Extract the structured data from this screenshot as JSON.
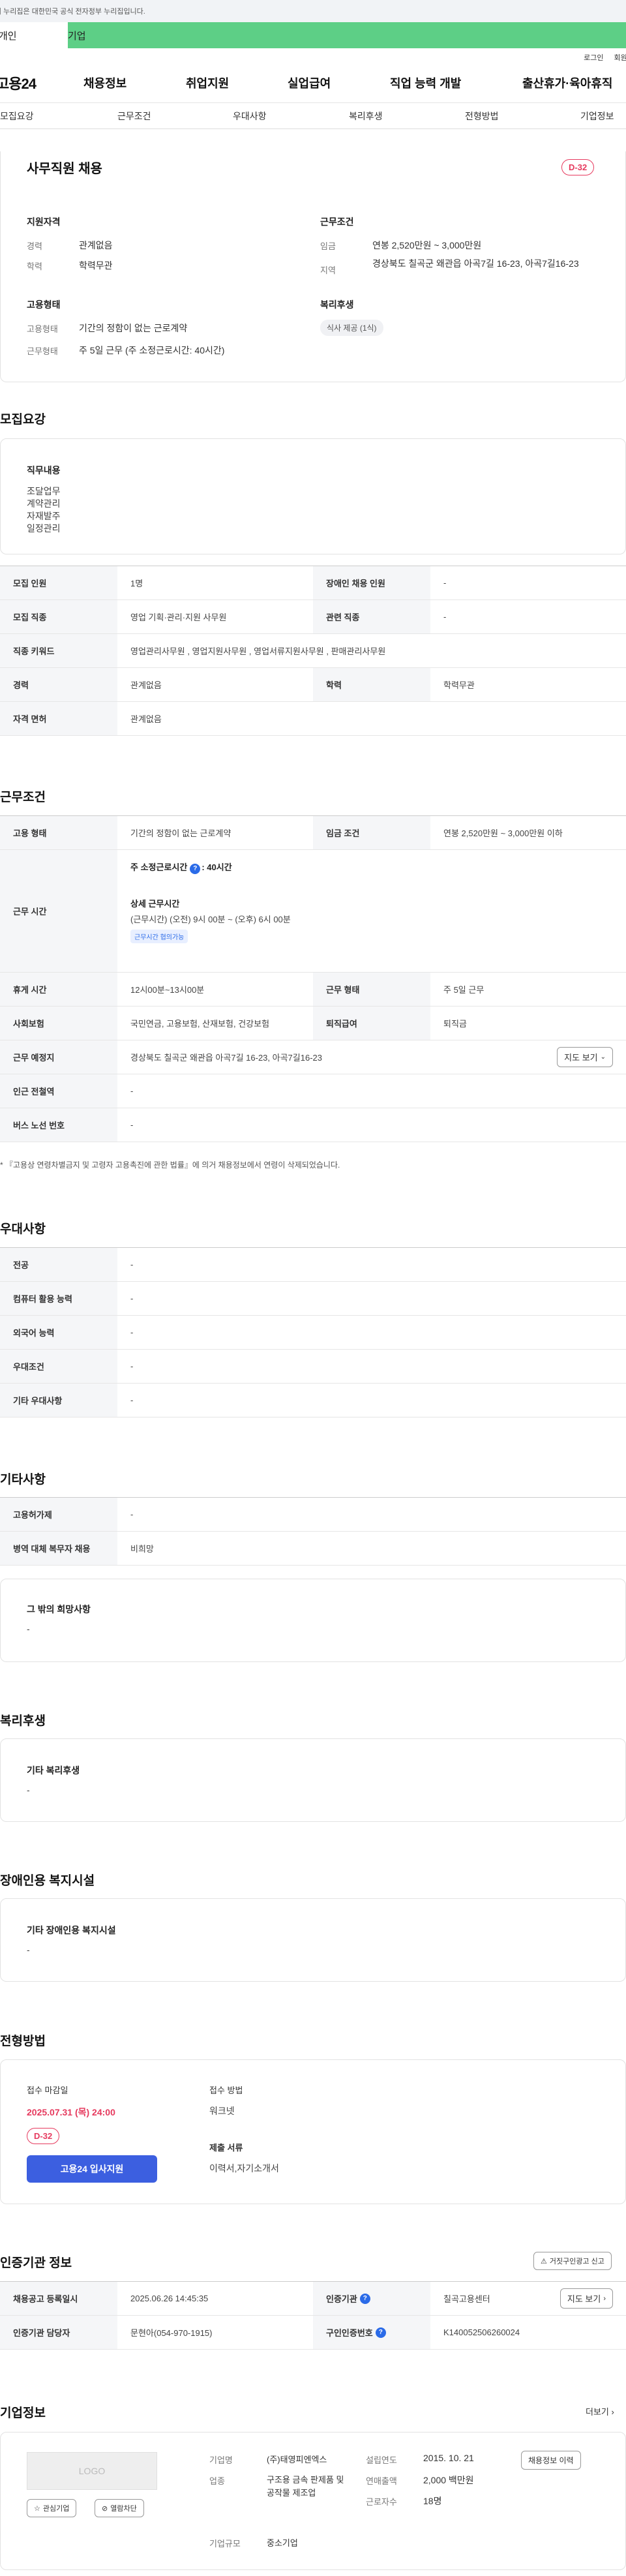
{
  "gov_bar": {
    "text": "이 누리집은 대한민국 공식 전자정부 누리집입니다."
  },
  "user_tabs": {
    "personal": "개인",
    "company": "기업"
  },
  "util": {
    "login": "로그인",
    "join": "회원가입"
  },
  "gnb": {
    "logo": "고용24",
    "items": [
      "채용정보",
      "취업지원",
      "실업급여",
      "직업 능력 개발",
      "출산휴가·육아휴직"
    ]
  },
  "subnav": [
    "모집요강",
    "근무조건",
    "우대사항",
    "복리후생",
    "전형방법",
    "기업정보"
  ],
  "summary": {
    "title": "사무직원 채용",
    "dday": "D-32",
    "qual_title": "지원자격",
    "career_label": "경력",
    "career_value": "관계없음",
    "edu_label": "학력",
    "edu_value": "학력무관",
    "work_title": "근무조건",
    "wage_label": "임금",
    "wage_value": "연봉 2,520만원 ~ 3,000만원",
    "region_label": "지역",
    "region_value": "경상북도 칠곡군 왜관읍 아곡7길 16-23, 아곡7길16-23",
    "emp_title": "고용형태",
    "emp_type_label": "고용형태",
    "emp_type_value": "기간의 정함이 없는 근로계약",
    "emp_form_label": "근무형태",
    "emp_form_value": "주 5일 근무 (주 소정근로시간: 40시간)",
    "welfare_title": "복리후생",
    "welfare_chip": "식사 제공 (1식)"
  },
  "recruit": {
    "title": "모집요강",
    "duty_title": "직무내용",
    "duty_lines": [
      "조달업무",
      "계약관리",
      "자재발주",
      "일정관리"
    ],
    "rows": [
      {
        "k1": "모집 인원",
        "v1": "1명",
        "k2": "장애인 채용 인원",
        "v2": "-"
      },
      {
        "k1": "모집 직종",
        "v1": "영업 기획·관리·지원 사무원",
        "k2": "관련 직종",
        "v2": "-"
      },
      {
        "k1": "직종 키워드",
        "v1": "영업관리사무원 , 영업지원사무원 , 영업서류지원사무원 , 판매관리사무원"
      },
      {
        "k1": "경력",
        "v1": "관계없음",
        "k2": "학력",
        "v2": "학력무관"
      },
      {
        "k1": "자격 면허",
        "v1": "관계없음"
      }
    ]
  },
  "work": {
    "title": "근무조건",
    "type_label": "고용 형태",
    "type_value": "기간의 정함이 없는 근로계약",
    "wage_label": "임금 조건",
    "wage_value": "연봉 2,520만원 ~ 3,000만원 이하",
    "hours_label": "근무 시간",
    "hours_main": "주 소정근로시간",
    "hours_main_value": ": 40시간",
    "hours_detail_title": "상세 근무시간",
    "hours_detail": "(근무시간) (오전) 9시 00분 ~ (오후) 6시 00분",
    "hours_tag": "근무시간 협의가능",
    "rest_label": "휴게 시간",
    "rest_value": "12시00분~13시00분",
    "form_label": "근무 형태",
    "form_value": "주 5일 근무",
    "ins_label": "사회보험",
    "ins_value": "국민연금, 고용보험, 산재보험, 건강보험",
    "sev_label": "퇴직급여",
    "sev_value": "퇴직금",
    "place_label": "근무 예정지",
    "place_value": "경상북도 칠곡군 왜관읍 아곡7길 16-23, 아곡7길16-23",
    "map_btn": "지도 보기",
    "station_label": "인근 전철역",
    "station_value": "-",
    "bus_label": "버스 노선 번호",
    "bus_value": "-",
    "note": "* 『고용상 연령차별금지 및 고령자 고용촉진에 관한 법률』에 의거 채용정보에서 연령이 삭제되었습니다."
  },
  "pref": {
    "title": "우대사항",
    "rows": [
      {
        "k": "전공",
        "v": "-"
      },
      {
        "k": "컴퓨터 활용 능력",
        "v": "-"
      },
      {
        "k": "외국어 능력",
        "v": "-"
      },
      {
        "k": "우대조건",
        "v": "-"
      },
      {
        "k": "기타 우대사항",
        "v": "-"
      }
    ]
  },
  "etc": {
    "title": "기타사항",
    "rows": [
      {
        "k": "고용허가제",
        "v": "-"
      },
      {
        "k": "병역 대체 복무자 채용",
        "v": "비희망"
      }
    ],
    "other_title": "그 밖의 희망사항",
    "other_value": "-"
  },
  "welfare": {
    "title": "복리후생",
    "box_title": "기타 복리후생",
    "box_value": "-"
  },
  "disability": {
    "title": "장애인용 복지시설",
    "box_title": "기타 장애인용 복지시설",
    "box_value": "-"
  },
  "process": {
    "title": "전형방법",
    "deadline_label": "접수 마감일",
    "deadline_value": "2025.07.31 (목) 24:00",
    "dday": "D-32",
    "apply_btn": "고용24 입사지원",
    "method_label": "접수 방법",
    "method_value": "워크넷",
    "docs_label": "제출 서류",
    "docs_value": "이력서,자기소개서"
  },
  "cert": {
    "title": "인증기관 정보",
    "report_btn": "거짓구인광고 신고",
    "r1_k1": "채용공고 등록일시",
    "r1_v1": "2025.06.26 14:45:35",
    "r1_k2": "인증기관",
    "r1_v2": "칠곡고용센터",
    "map_btn": "지도 보기",
    "r2_k1": "인증기관 담당자",
    "r2_v1": "문현아(054-970-1915)",
    "r2_k2": "구인인증번호",
    "r2_v2": "K140052506260024"
  },
  "company": {
    "title": "기업정보",
    "more": "더보기",
    "logo": "LOGO",
    "fav_btn": "관심기업",
    "block_btn": "열람차단",
    "name_label": "기업명",
    "name_value": "(주)태영피엔엑스",
    "found_label": "설립연도",
    "found_value": "2015. 10. 21",
    "history_btn": "채용정보 이력",
    "industry_label": "업종",
    "industry_value": "구조용 금속 판제품 및 공작물 제조업",
    "sales_label": "연매출액",
    "sales_value": "2,000 백만원",
    "emp_label": "근로자수",
    "emp_value": "18명",
    "size_label": "기업규모",
    "size_value": "중소기업"
  }
}
